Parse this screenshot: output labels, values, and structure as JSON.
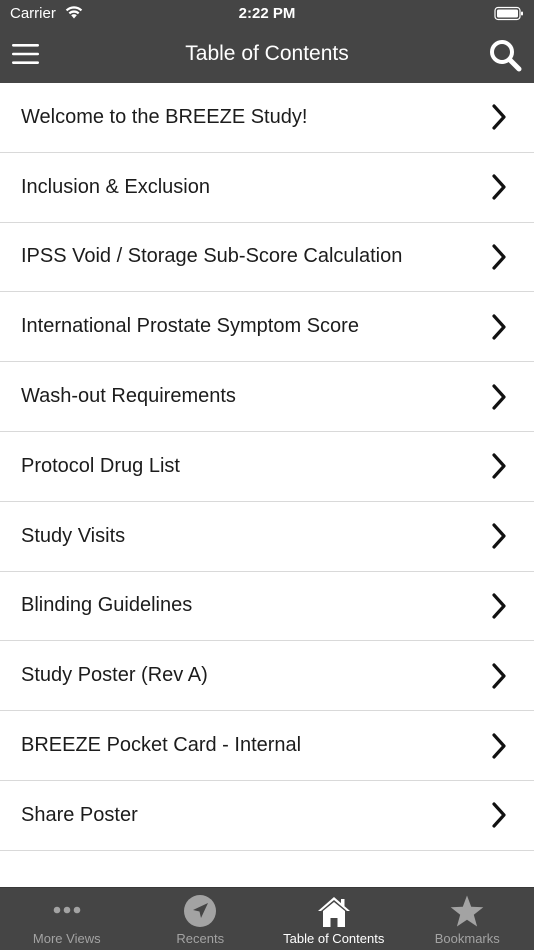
{
  "status_bar": {
    "carrier": "Carrier",
    "time": "2:22 PM"
  },
  "nav": {
    "title": "Table of Contents"
  },
  "toc": {
    "items": [
      {
        "label": "Welcome to the BREEZE Study!"
      },
      {
        "label": "Inclusion & Exclusion"
      },
      {
        "label": "IPSS Void / Storage Sub-Score Calculation"
      },
      {
        "label": "International Prostate Symptom Score"
      },
      {
        "label": "Wash-out Requirements"
      },
      {
        "label": "Protocol Drug List"
      },
      {
        "label": "Study Visits"
      },
      {
        "label": "Blinding Guidelines"
      },
      {
        "label": "Study Poster (Rev A)"
      },
      {
        "label": "BREEZE Pocket Card - Internal"
      },
      {
        "label": "Share Poster"
      }
    ]
  },
  "tab_bar": {
    "tabs": [
      {
        "label": "More Views",
        "icon": "more-dots-icon",
        "active": false
      },
      {
        "label": "Recents",
        "icon": "compass-arrow-icon",
        "active": false
      },
      {
        "label": "Table of Contents",
        "icon": "home-icon",
        "active": true
      },
      {
        "label": "Bookmarks",
        "icon": "star-icon",
        "active": false
      }
    ]
  },
  "colors": {
    "bar_background": "#454545",
    "active_tab": "#ffffff",
    "inactive_tab": "#a3a3a3",
    "separator": "#d9d9d9"
  }
}
